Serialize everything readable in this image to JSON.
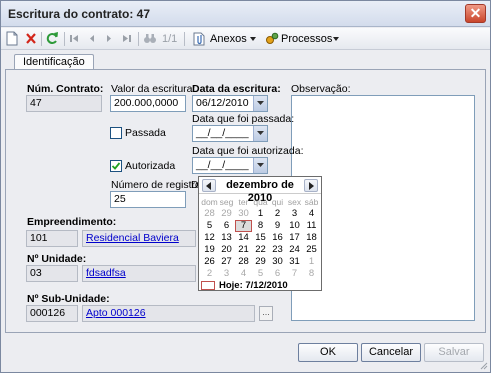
{
  "window": {
    "title": "Escritura do contrato: 47"
  },
  "toolbar": {
    "page_indicator": "1/1",
    "anexos_label": "Anexos",
    "processos_label": "Processos"
  },
  "tabs": [
    {
      "label": "Identificação"
    }
  ],
  "form": {
    "num_contrato": {
      "label": "Núm. Contrato:",
      "value": "47"
    },
    "valor_escritura": {
      "label": "Valor da escritura:",
      "value": "200.000,0000"
    },
    "data_escritura": {
      "label": "Data da escritura:",
      "value": "06/12/2010"
    },
    "passada": {
      "label": "Passada",
      "checked": false
    },
    "data_passada": {
      "label": "Data que foi passada:",
      "value": "__/__/____"
    },
    "autorizada": {
      "label": "Autorizada",
      "checked": true
    },
    "data_autorizada": {
      "label": "Data que foi autorizada:",
      "value": "__/__/____"
    },
    "numero_registro": {
      "label": "Número de registro:",
      "value": "25"
    },
    "data_registro_partial_label": "D",
    "observacao": {
      "label": "Observação:"
    },
    "empreendimento": {
      "label": "Empreendimento:",
      "code": "101",
      "name": "Residencial Baviera"
    },
    "unidade": {
      "label": "Nº Unidade:",
      "code": "03",
      "name": "fdsadfsa"
    },
    "sub_unidade": {
      "label": "Nº Sub-Unidade:",
      "code": "000126",
      "name": "Apto 000126",
      "lookup_label": "..."
    }
  },
  "calendar": {
    "month_label": "dezembro de 2010",
    "weekdays": [
      "dom",
      "seg",
      "ter",
      "qua",
      "qui",
      "sex",
      "sáb"
    ],
    "weeks": [
      [
        "28",
        "29",
        "30",
        "1",
        "2",
        "3",
        "4"
      ],
      [
        "5",
        "6",
        "7",
        "8",
        "9",
        "10",
        "11"
      ],
      [
        "12",
        "13",
        "14",
        "15",
        "16",
        "17",
        "18"
      ],
      [
        "19",
        "20",
        "21",
        "22",
        "23",
        "24",
        "25"
      ],
      [
        "26",
        "27",
        "28",
        "29",
        "30",
        "31",
        "1"
      ],
      [
        "2",
        "3",
        "4",
        "5",
        "6",
        "7",
        "8"
      ]
    ],
    "selected_day": "7",
    "today_label": "Hoje: 7/12/2010"
  },
  "buttons": {
    "ok": "OK",
    "cancelar": "Cancelar",
    "salvar": "Salvar"
  }
}
